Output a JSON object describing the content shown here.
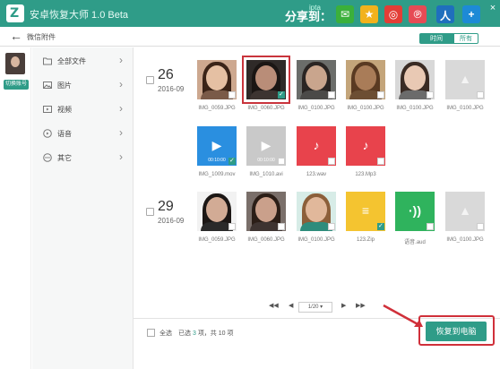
{
  "titlebar": {
    "app_title": "安卓恢复大师 1.0 Beta",
    "share_label": "分享到：",
    "share_tiny": "ipta",
    "share_icons": [
      {
        "name": "wechat-icon",
        "color": "#3bb03b",
        "glyph": "✉"
      },
      {
        "name": "qzone-icon",
        "color": "#f2b21c",
        "glyph": "★"
      },
      {
        "name": "weibo-icon",
        "color": "#e33d36",
        "glyph": "◎"
      },
      {
        "name": "tencent-weibo-icon",
        "color": "#e64b55",
        "glyph": "℗"
      },
      {
        "name": "renren-icon",
        "color": "#1f6fbd",
        "glyph": "人"
      },
      {
        "name": "add-more-icon",
        "color": "#1d8ad6",
        "glyph": "+"
      }
    ],
    "close_glyph": "×"
  },
  "nav": {
    "breadcrumb": "微信附件",
    "seg_time": "时间",
    "seg_all": "所有"
  },
  "account": {
    "switch_label": "切换账号"
  },
  "sidebar": {
    "items": [
      {
        "label": "全部文件",
        "icon": "folder-icon"
      },
      {
        "label": "图片",
        "icon": "image-icon"
      },
      {
        "label": "视频",
        "icon": "video-icon"
      },
      {
        "label": "语音",
        "icon": "audio-icon"
      },
      {
        "label": "其它",
        "icon": "more-icon"
      }
    ]
  },
  "groups": [
    {
      "day": "26",
      "month": "2016-09"
    },
    {
      "day": "29",
      "month": "2016-09"
    }
  ],
  "tiles": [
    {
      "name": "IMG_0059.JPG",
      "kind": "photo",
      "bg": "#cda88f",
      "hair": "#3b2418",
      "face": "#e5c0a3",
      "body": "#7a5a48",
      "checked": false,
      "selected": false
    },
    {
      "name": "IMG_0060.JPG",
      "kind": "photo",
      "bg": "#2f2a28",
      "hair": "#1b1614",
      "face": "#b98d78",
      "body": "#3d3431",
      "checked": true,
      "selected": true
    },
    {
      "name": "IMG_0100.JPG",
      "kind": "photo",
      "bg": "#6b6d6a",
      "hair": "#2a2523",
      "face": "#c9a58d",
      "body": "#4b4a48",
      "checked": false,
      "selected": false
    },
    {
      "name": "IMG_0100.JPG",
      "kind": "photo",
      "bg": "#c4a57a",
      "hair": "#5a3a22",
      "face": "#a97c58",
      "body": "#6c4e33",
      "checked": false,
      "selected": false
    },
    {
      "name": "IMG_0100.JPG",
      "kind": "photo",
      "bg": "#d8d8d8",
      "hair": "#3a2b24",
      "face": "#e9c9b4",
      "body": "#6b6b6b",
      "checked": false,
      "selected": false
    },
    {
      "name": "IMG_0100.JPG",
      "kind": "placeholder",
      "bg": "#d9d9d9",
      "glyph": "▲",
      "checked": false,
      "selected": false
    },
    {
      "name": "IMG_1009.mov",
      "kind": "video",
      "bg": "#2a8fe0",
      "glyph": "▶",
      "duration": "00:10:00",
      "checked": true,
      "selected": false
    },
    {
      "name": "IMG_1010.avi",
      "kind": "video",
      "bg": "#c9c9c9",
      "glyph": "▶",
      "duration": "00:10:00",
      "checked": false,
      "selected": false
    },
    {
      "name": "123.wav",
      "kind": "audio",
      "bg": "#e8434c",
      "glyph": "♪",
      "checked": false,
      "selected": false
    },
    {
      "name": "123.Mp3",
      "kind": "audio",
      "bg": "#e8434c",
      "glyph": "♪",
      "checked": false,
      "selected": false
    },
    {
      "name": "IMG_0059.JPG",
      "kind": "photo",
      "bg": "#f2f2f2",
      "hair": "#1c1715",
      "face": "#d2ab95",
      "body": "#2a2a2a",
      "checked": false,
      "selected": false
    },
    {
      "name": "IMG_0060.JPG",
      "kind": "photo",
      "bg": "#7a6f6a",
      "hair": "#2b1e17",
      "face": "#caa08b",
      "body": "#3e3431",
      "checked": false,
      "selected": false
    },
    {
      "name": "IMG_0100.JPG",
      "kind": "photo",
      "bg": "#d7ece7",
      "hair": "#8c5f3a",
      "face": "#e1b89b",
      "body": "#2e8c7c",
      "checked": false,
      "selected": false
    },
    {
      "name": "123.Zip",
      "kind": "doc",
      "bg": "#f4c430",
      "glyph": "≡",
      "checked": true,
      "selected": false
    },
    {
      "name": "语音.aud",
      "kind": "voice",
      "bg": "#2fb35d",
      "glyph": "·))",
      "checked": false,
      "selected": false
    },
    {
      "name": "IMG_0100.JPG",
      "kind": "placeholder",
      "bg": "#d9d9d9",
      "glyph": "▲",
      "checked": false,
      "selected": false
    }
  ],
  "pagination": {
    "first": "◀◀",
    "prev": "◀",
    "page": "1/20 ▾",
    "next": "▶",
    "last": "▶▶"
  },
  "bottom": {
    "select_all": "全选",
    "selected_prefix": "已选",
    "selected_count": "3",
    "selected_mid": "项，共",
    "total_count": "10",
    "selected_suffix": "项",
    "restore_label": "恢复到电脑"
  }
}
